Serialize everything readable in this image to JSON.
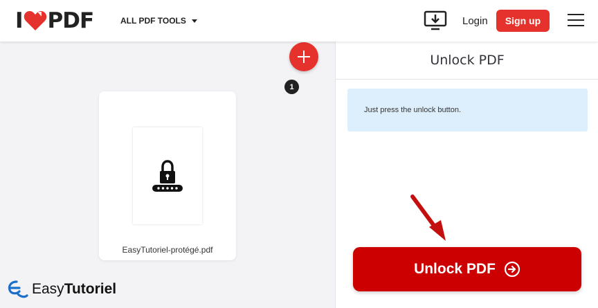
{
  "header": {
    "logo_left": "I",
    "logo_right": "PDF",
    "tools_menu_label": "ALL PDF TOOLS",
    "login_label": "Login",
    "signup_label": "Sign up",
    "icons": {
      "desktop": "download-desktop-icon",
      "menu": "hamburger-menu-icon",
      "tools_caret": "caret-down-icon"
    }
  },
  "workspace": {
    "file_name": "EasyTutoriel-protégé.pdf",
    "file_count": "1",
    "icons": {
      "thumbnail": "lock-password-icon",
      "add": "plus-icon"
    }
  },
  "watermark": {
    "prefix": "Easy",
    "suffix": "Tutoriel"
  },
  "panel": {
    "title": "Unlock PDF",
    "info_text": "Just press the unlock button.",
    "action_label": "Unlock PDF",
    "icons": {
      "action": "arrow-right-circle-icon"
    }
  },
  "colors": {
    "brand_red": "#e5322d",
    "action_red": "#cc0000",
    "info_bg": "#ddeefc"
  }
}
